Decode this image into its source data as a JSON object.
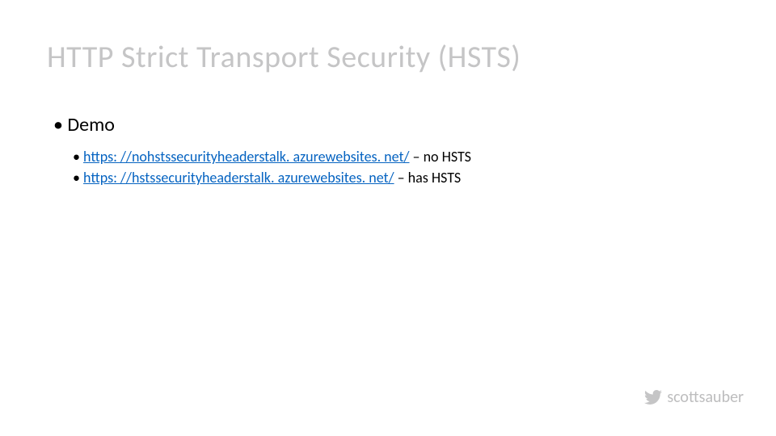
{
  "title": "HTTP Strict Transport Security (HSTS)",
  "bullet": "Demo",
  "sub": [
    {
      "link": "https: //nohstssecurityheaderstalk. azurewebsites. net/",
      "suffix": " – no HSTS"
    },
    {
      "link": "https: //hstssecurityheaderstalk. azurewebsites. net/",
      "suffix": " – has HSTS"
    }
  ],
  "footer_handle": "scottsauber"
}
